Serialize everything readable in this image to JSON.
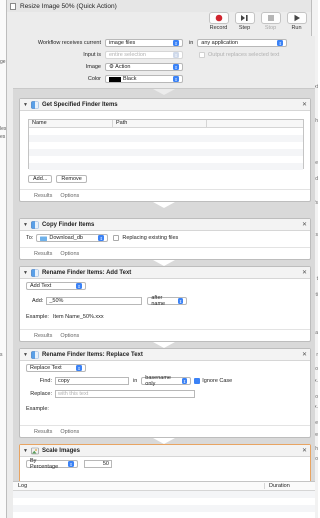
{
  "window": {
    "title": "Resize Image 50% (Quick Action)"
  },
  "toolbar": {
    "record": "Record",
    "step": "Step",
    "stop": "Stop",
    "run": "Run"
  },
  "left_fragments": [
    "ge",
    "les",
    "es",
    "s"
  ],
  "right_fragments": [
    "xt",
    "ph",
    "Re",
    "d",
    "fs",
    "s",
    "t",
    "ti",
    "a",
    "r",
    "co",
    "x.",
    "Fo",
    "fx.",
    "Fe",
    "we",
    "Th",
    "co"
  ],
  "workflow_header": {
    "receives_label": "Workflow receives current",
    "receives_value": "image files",
    "in_label": "in",
    "in_value": "any application",
    "input_label": "Input is",
    "input_value": "entire selection",
    "output_replaces_label": "Output replaces selected text",
    "image_label": "Image",
    "image_value": "Action",
    "color_label": "Color",
    "color_value": "Black"
  },
  "actions": {
    "get_items": {
      "title": "Get Specified Finder Items",
      "col_name": "Name",
      "col_path": "Path",
      "add_button": "Add...",
      "remove_button": "Remove"
    },
    "copy_items": {
      "title": "Copy Finder Items",
      "to_label": "To:",
      "to_value": "Download_db",
      "replacing_label": "Replacing existing files"
    },
    "rename_add": {
      "title": "Rename Finder Items: Add Text",
      "mode_value": "Add Text",
      "add_label": "Add:",
      "add_value": "_50%",
      "position_value": "after name",
      "example_label": "Example:",
      "example_value": "Item Name_50%.xxx"
    },
    "rename_replace": {
      "title": "Rename Finder Items: Replace Text",
      "mode_value": "Replace Text",
      "find_label": "Find:",
      "find_value": "copy",
      "in_label": "in",
      "in_value": "basename only",
      "ignore_case_label": "Ignore Case",
      "replace_label": "Replace:",
      "replace_placeholder": "with this text",
      "example_label": "Example:"
    },
    "scale": {
      "title": "Scale Images",
      "mode_value": "By Percentage",
      "percent_value": "50"
    },
    "footer": {
      "results": "Results",
      "options": "Options"
    }
  },
  "log": {
    "col_log": "Log",
    "col_duration": "Duration"
  }
}
